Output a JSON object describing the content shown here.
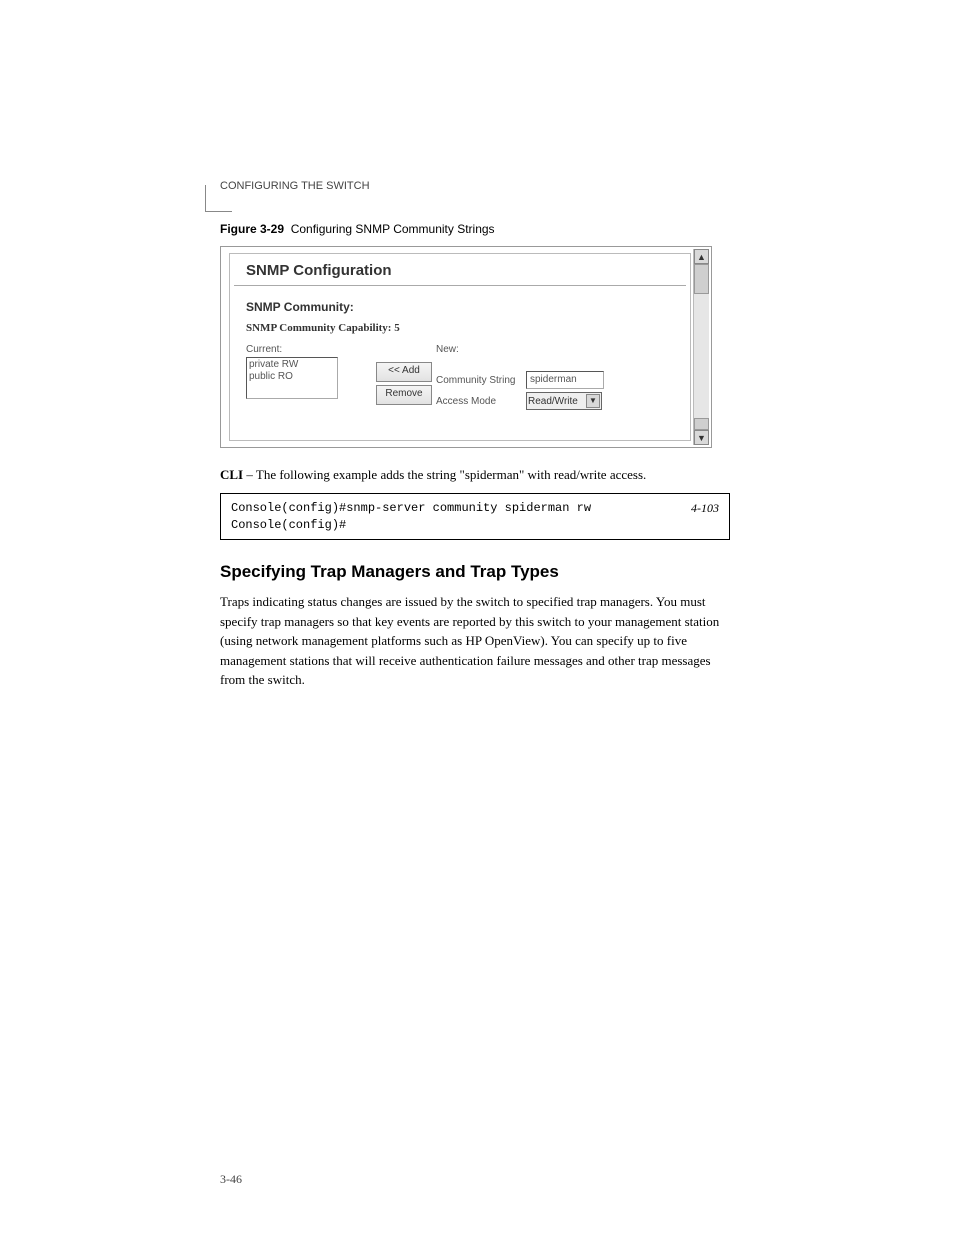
{
  "header": {
    "running_head": "CONFIGURING THE SWITCH"
  },
  "figure": {
    "number": "Figure 3-29",
    "caption": "Configuring SNMP Community Strings"
  },
  "snmp_panel": {
    "title": "SNMP Configuration",
    "section_label": "SNMP Community:",
    "capability_label": "SNMP Community Capability: 5",
    "current_label": "Current:",
    "new_label": "New:",
    "list_items": [
      "private RW",
      "public RO"
    ],
    "add_button": "<< Add",
    "remove_button": "Remove",
    "community_string_label": "Community String",
    "community_string_value": "spiderman",
    "access_mode_label": "Access Mode",
    "access_mode_value": "Read/Write"
  },
  "cli": {
    "intro": "CLI – The following example adds the string \"spiderman\" with read/write access.",
    "line1": "Console(config)#snmp-server community spiderman rw",
    "line2": "Console(config)#",
    "page_ref": "4-103"
  },
  "section": {
    "heading": "Specifying Trap Managers and Trap Types",
    "body": "Traps indicating status changes are issued by the switch to specified trap managers. You must specify trap managers so that key events are reported by this switch to your management station (using network management platforms such as HP OpenView). You can specify up to five management stations that will receive authentication failure messages and other trap messages from the switch."
  },
  "footer": {
    "page_number": "3-46"
  }
}
